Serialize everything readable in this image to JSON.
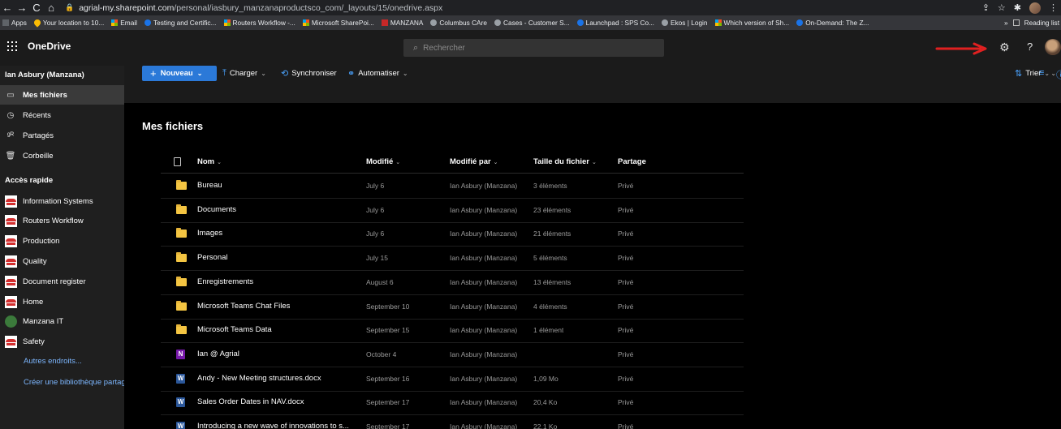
{
  "browser": {
    "url_host": "agrial-my.sharepoint.com",
    "url_path": "/personal/iasbury_manzanaproductsco_com/_layouts/15/onedrive.aspx",
    "bookmarks": [
      {
        "label": "Apps",
        "icon": "grid"
      },
      {
        "label": "Your location to 10...",
        "icon": "pin"
      },
      {
        "label": "Email",
        "icon": "ms"
      },
      {
        "label": "Testing and Certific...",
        "icon": "blue"
      },
      {
        "label": "Routers Workflow -...",
        "icon": "ms"
      },
      {
        "label": "Microsoft SharePoi...",
        "icon": "ms"
      },
      {
        "label": "MANZANA",
        "icon": "red"
      },
      {
        "label": "Columbus CAre",
        "icon": "gh"
      },
      {
        "label": "Cases - Customer S...",
        "icon": "gh"
      },
      {
        "label": "Launchpad : SPS Co...",
        "icon": "blue"
      },
      {
        "label": "Ekos | Login",
        "icon": "gh"
      },
      {
        "label": "Which version of Sh...",
        "icon": "ms"
      },
      {
        "label": "On-Demand: The Z...",
        "icon": "blue"
      }
    ],
    "more_label": "»",
    "reading_list": "Reading list"
  },
  "app": {
    "name": "OneDrive",
    "search_placeholder": "Rechercher"
  },
  "sidebar": {
    "user": "Ian Asbury (Manzana)",
    "items": [
      {
        "label": "Mes fichiers",
        "icon": "▭",
        "active": true
      },
      {
        "label": "Récents",
        "icon": "◷"
      },
      {
        "label": "Partagés",
        "icon": "ᵍᴿ"
      },
      {
        "label": "Corbeille",
        "icon": "🗑"
      }
    ],
    "quick_access_header": "Accès rapide",
    "quick_access": [
      {
        "label": "Information Systems"
      },
      {
        "label": "Routers Workflow"
      },
      {
        "label": "Production"
      },
      {
        "label": "Quality"
      },
      {
        "label": "Document register"
      },
      {
        "label": "Home"
      },
      {
        "label": "Manzana IT"
      },
      {
        "label": "Safety"
      }
    ],
    "more_places": "Autres endroits...",
    "create_library": "Créer une bibliothèque partagée"
  },
  "commands": {
    "new": "Nouveau",
    "upload": "Charger",
    "sync": "Synchroniser",
    "automate": "Automatiser",
    "sort": "Trier"
  },
  "main": {
    "title": "Mes fichiers",
    "columns": {
      "name": "Nom",
      "modified": "Modifié",
      "modified_by": "Modifié par",
      "size": "Taille du fichier",
      "sharing": "Partage"
    },
    "rows": [
      {
        "type": "folder",
        "name": "Bureau",
        "modified": "July 6",
        "modified_by": "Ian Asbury (Manzana)",
        "size": "3 éléments",
        "sharing": "Privé"
      },
      {
        "type": "folder",
        "name": "Documents",
        "modified": "July 6",
        "modified_by": "Ian Asbury (Manzana)",
        "size": "23 éléments",
        "sharing": "Privé"
      },
      {
        "type": "folder",
        "name": "Images",
        "modified": "July 6",
        "modified_by": "Ian Asbury (Manzana)",
        "size": "21 éléments",
        "sharing": "Privé"
      },
      {
        "type": "folder",
        "name": "Personal",
        "modified": "July 15",
        "modified_by": "Ian Asbury (Manzana)",
        "size": "5 éléments",
        "sharing": "Privé"
      },
      {
        "type": "folder",
        "name": "Enregistrements",
        "modified": "August 6",
        "modified_by": "Ian Asbury (Manzana)",
        "size": "13 éléments",
        "sharing": "Privé"
      },
      {
        "type": "folder",
        "name": "Microsoft Teams Chat Files",
        "modified": "September 10",
        "modified_by": "Ian Asbury (Manzana)",
        "size": "4 éléments",
        "sharing": "Privé"
      },
      {
        "type": "folder",
        "name": "Microsoft Teams Data",
        "modified": "September 15",
        "modified_by": "Ian Asbury (Manzana)",
        "size": "1 élément",
        "sharing": "Privé"
      },
      {
        "type": "onenote",
        "name": "Ian @ Agrial",
        "modified": "October 4",
        "modified_by": "Ian Asbury (Manzana)",
        "size": "",
        "sharing": "Privé"
      },
      {
        "type": "word",
        "name": "Andy - New Meeting structures.docx",
        "modified": "September 16",
        "modified_by": "Ian Asbury (Manzana)",
        "size": "1,09 Mo",
        "sharing": "Privé"
      },
      {
        "type": "word",
        "name": "Sales Order Dates in NAV.docx",
        "modified": "September 17",
        "modified_by": "Ian Asbury (Manzana)",
        "size": "20,4 Ko",
        "sharing": "Privé"
      },
      {
        "type": "word",
        "name": "Introducing a new wave of innovations to s...",
        "modified": "September 17",
        "modified_by": "Ian Asbury (Manzana)",
        "size": "22,1 Ko",
        "sharing": "Privé"
      }
    ]
  },
  "colors": {
    "accent": "#2b79d8",
    "annotation_arrow": "#e02020",
    "link": "#7db7ff",
    "folder": "#f4c542"
  }
}
